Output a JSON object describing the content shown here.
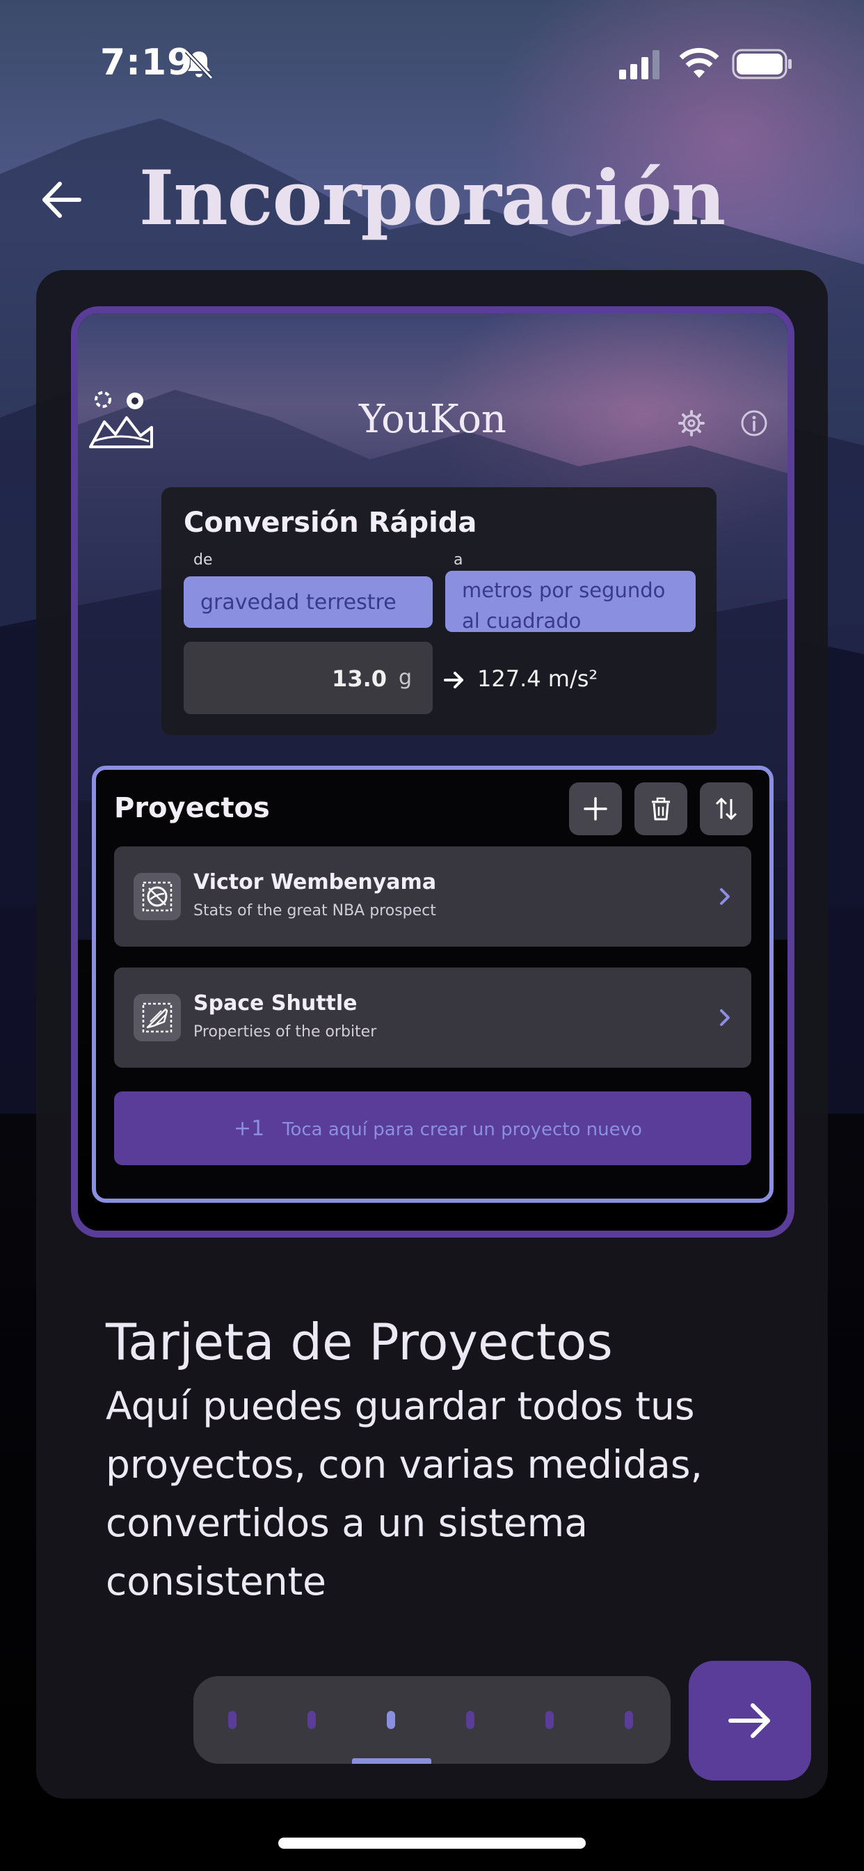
{
  "status_bar": {
    "time": "7:19"
  },
  "header": {
    "title": "Incorporación"
  },
  "preview": {
    "app_title": "YouKon",
    "quick_conversion": {
      "title": "Conversión Rápida",
      "from_label": "de",
      "to_label": "a",
      "from_unit": "gravedad terrestre",
      "to_unit": "metros por segundo al cuadrado",
      "input_value": "13.0",
      "input_unit": "g",
      "result": "127.4 m/s²"
    },
    "projects": {
      "title": "Proyectos",
      "items": [
        {
          "name": "Victor Wembenyama",
          "description": "Stats of the great NBA prospect"
        },
        {
          "name": "Space Shuttle",
          "description": "Properties of the orbiter"
        }
      ],
      "new_plus": "+1",
      "new_label": "Toca aquí para crear un proyecto nuevo"
    }
  },
  "description": {
    "title": "Tarjeta de Proyectos",
    "body": "Aquí puedes guardar todos tus proyectos, con varias medidas, convertidos a un sistema consistente"
  },
  "pager": {
    "total_pages": 6,
    "current_page": 3
  },
  "colors": {
    "accent": "#5a3d98",
    "accent_light": "#8b8fe0",
    "panel": "#16161c"
  }
}
